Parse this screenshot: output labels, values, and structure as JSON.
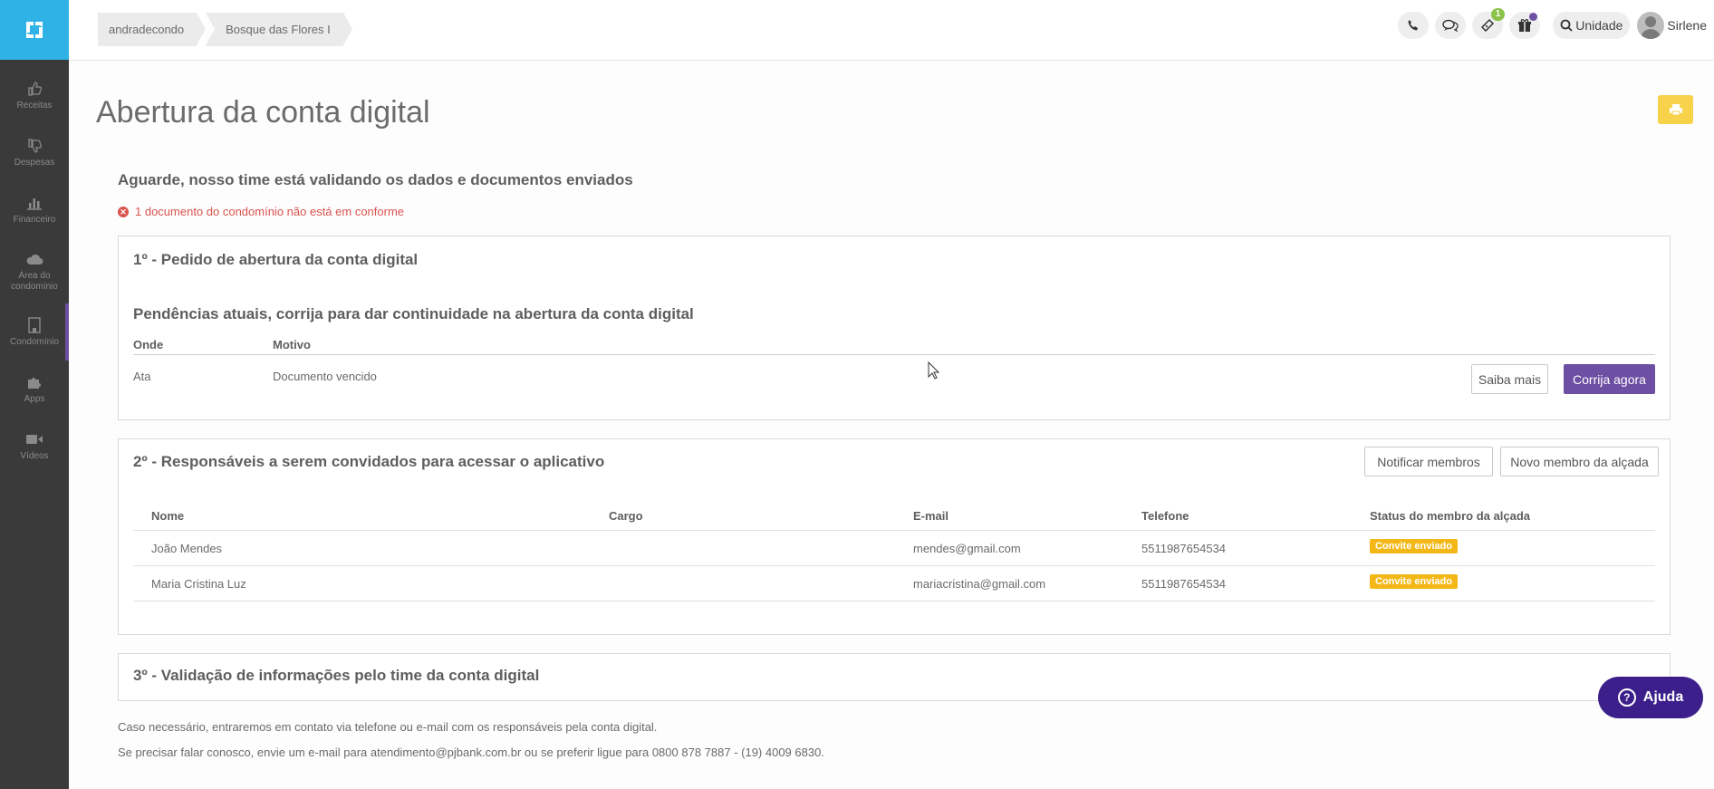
{
  "topbar": {
    "breadcrumbs": [
      "andradecondo",
      "Bosque das Flores I"
    ],
    "notifications_count": "1",
    "unit_label": "Unidade",
    "user_name": "Sirlene"
  },
  "sidebar": {
    "items": [
      {
        "label": "Receitas",
        "icon": "thumbs-up-icon"
      },
      {
        "label": "Despesas",
        "icon": "thumbs-down-icon"
      },
      {
        "label": "Financeiro",
        "icon": "bar-chart-icon"
      },
      {
        "label": "Área do condomínio",
        "icon": "cloud-icon"
      },
      {
        "label": "Condomínio",
        "icon": "building-icon"
      },
      {
        "label": "Apps",
        "icon": "puzzle-icon"
      },
      {
        "label": "Vídeos",
        "icon": "video-icon"
      }
    ]
  },
  "main": {
    "title": "Abertura da conta digital",
    "subtitle": "Aguarde, nosso time está validando os dados e documentos enviados",
    "warning": "1 documento do condomínio não está em conforme",
    "section1": {
      "title": "1º - Pedido de abertura da conta digital",
      "pending_title": "Pendências atuais, corrija para dar continuidade na abertura da conta digital",
      "columns": [
        "Onde",
        "Motivo"
      ],
      "rows": [
        {
          "onde": "Ata",
          "motivo": "Documento vencido"
        }
      ],
      "learn_more": "Saiba mais",
      "fix_now": "Corrija agora"
    },
    "section2": {
      "title": "2º - Responsáveis a serem convidados para acessar o aplicativo",
      "notify_button": "Notificar membros",
      "new_member_button": "Novo membro da alçada",
      "columns": [
        "Nome",
        "Cargo",
        "E-mail",
        "Telefone",
        "Status do membro da alçada"
      ],
      "rows": [
        {
          "nome": "João Mendes",
          "cargo": "",
          "email": "mendes@gmail.com",
          "telefone": "5511987654534",
          "status": "Convite enviado"
        },
        {
          "nome": "Maria Cristina Luz",
          "cargo": "",
          "email": "mariacristina@gmail.com",
          "telefone": "5511987654534",
          "status": "Convite enviado"
        }
      ]
    },
    "section3": {
      "title": "3º - Validação de informações pelo time da conta digital"
    },
    "footer": [
      "Caso necessário, entraremos em contato via telefone ou e-mail com os responsáveis pela conta digital.",
      "Se precisar falar conosco, envie um e-mail para atendimento@pjbank.com.br ou se preferir ligue para 0800 878 7887 - (19) 4009 6830."
    ]
  },
  "help_button": "Ajuda",
  "colors": {
    "sidebar": "#3a3a3a",
    "logo": "#2fb3e6",
    "primary": "#6d4fa3",
    "warning": "#d9534f",
    "tag": "#f3b818",
    "print": "#f7d24a",
    "help": "#3c1f8a"
  }
}
